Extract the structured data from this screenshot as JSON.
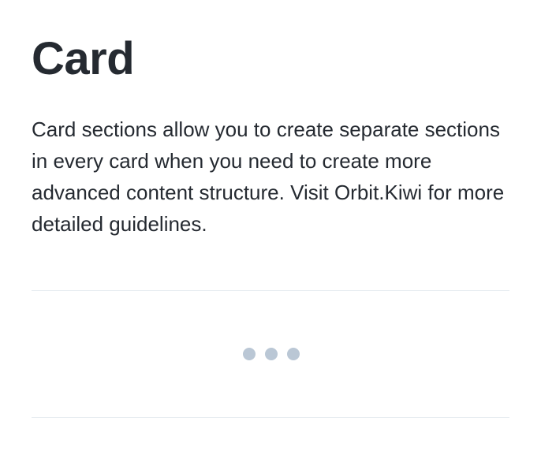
{
  "card": {
    "title": "Card",
    "description": "Card sections allow you to create separate sections in every card when you need to create more advanced content structure. Visit Orbit.Kiwi for more detailed guidelines."
  },
  "loader": {
    "dot_count": 3,
    "dot_color": "#bac7d5"
  },
  "colors": {
    "text": "#252a31",
    "divider": "#e8edf1",
    "background": "#ffffff"
  }
}
